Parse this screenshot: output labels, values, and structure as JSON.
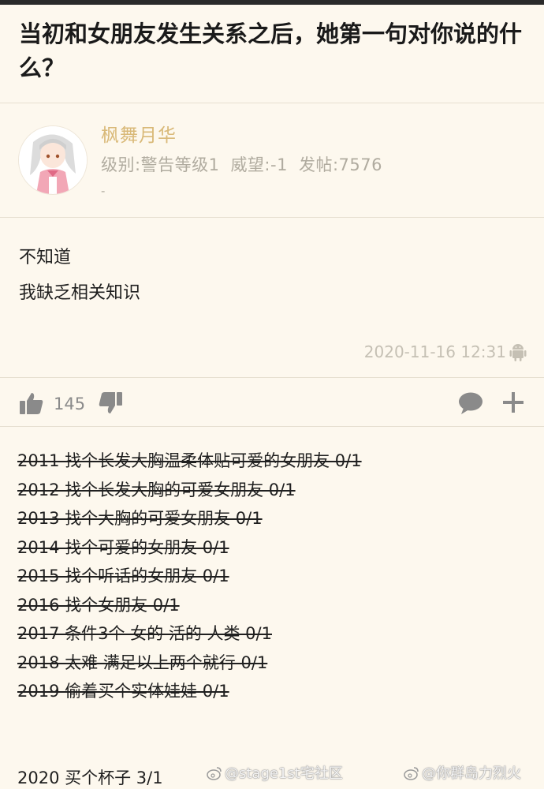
{
  "post": {
    "title": "当初和女朋友发生关系之后，她第一句对你说的什么？"
  },
  "author": {
    "name": "枫舞月华",
    "level": "级别:警告等级1",
    "prestige": "威望:-1",
    "posts": "发帖:7576",
    "signature_short": "-",
    "avatar_icon": "anime-girl-avatar"
  },
  "reply": {
    "lines": [
      "不知道",
      "我缺乏相关知识"
    ],
    "timestamp": "2020-11-16 12:31",
    "device_icon": "android-icon"
  },
  "actions": {
    "like_count": "145",
    "icons": [
      "thumbs-up-icon",
      "thumbs-down-icon",
      "comment-icon",
      "plus-icon"
    ]
  },
  "signature": {
    "struck_lines": [
      "2011 找个长发大胸温柔体贴可爱的女朋友 0/1",
      "2012 找个长发大胸的可爱女朋友 0/1",
      "2013 找个大胸的可爱女朋友 0/1",
      "2014 找个可爱的女朋友 0/1",
      "2015 找个听话的女朋友 0/1",
      "2016 找个女朋友 0/1",
      "2017 条件3个 女的 活的 人类 0/1",
      "2018 太难 满足以上两个就行 0/1",
      "2019 偷着买个实体娃娃 0/1"
    ],
    "final_line": "2020 买个杯子 3/1"
  },
  "watermarks": {
    "left": "@stage1st宅社区",
    "right": "@你群岛力烈火"
  },
  "colors": {
    "background": "#fdf8ee",
    "username": "#d9b978",
    "meta_text": "#b0ab9f",
    "icon_gray": "#8a8a8a"
  }
}
